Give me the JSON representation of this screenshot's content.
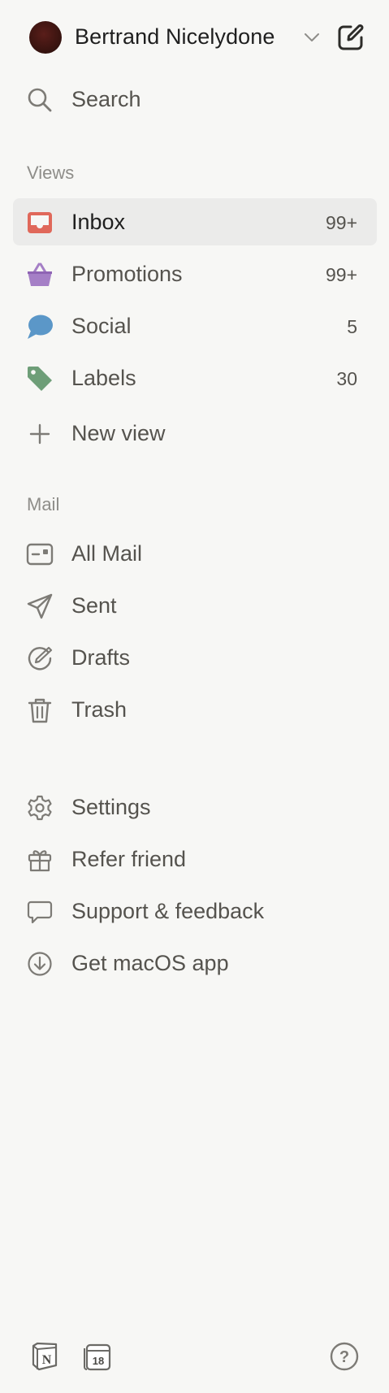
{
  "account": {
    "name": "Bertrand Nicelydone"
  },
  "search": {
    "label": "Search"
  },
  "views": {
    "title": "Views",
    "items": [
      {
        "label": "Inbox",
        "count": "99+",
        "icon": "inbox-icon",
        "color": "#e0685a"
      },
      {
        "label": "Promotions",
        "count": "99+",
        "icon": "basket-icon",
        "color": "#a57fc6"
      },
      {
        "label": "Social",
        "count": "5",
        "icon": "chat-bubble-icon",
        "color": "#5b97c8"
      },
      {
        "label": "Labels",
        "count": "30",
        "icon": "tag-icon",
        "color": "#6e9e78"
      }
    ],
    "new_view": "New view"
  },
  "mail": {
    "title": "Mail",
    "items": [
      {
        "label": "All Mail",
        "icon": "mailbox-icon"
      },
      {
        "label": "Sent",
        "icon": "paper-plane-icon"
      },
      {
        "label": "Drafts",
        "icon": "draft-pen-icon"
      },
      {
        "label": "Trash",
        "icon": "trash-icon"
      }
    ]
  },
  "misc": {
    "items": [
      {
        "label": "Settings",
        "icon": "gear-icon"
      },
      {
        "label": "Refer friend",
        "icon": "gift-icon"
      },
      {
        "label": "Support & feedback",
        "icon": "comment-icon"
      },
      {
        "label": "Get macOS app",
        "icon": "download-icon"
      }
    ]
  },
  "footer": {
    "notion_letter": "N",
    "calendar_day": "18",
    "help_symbol": "?"
  },
  "active_view": "Inbox",
  "accent_gray": "#ebebea"
}
